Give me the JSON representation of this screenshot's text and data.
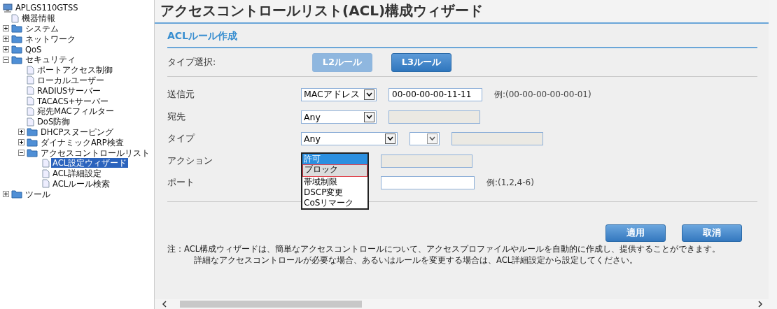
{
  "tree": {
    "root": "APLGS110GTSS",
    "items": [
      {
        "label": "機器情報",
        "kind": "page",
        "selected": false
      },
      {
        "label": "システム",
        "kind": "folder",
        "expanded": false
      },
      {
        "label": "ネットワーク",
        "kind": "folder",
        "expanded": false
      },
      {
        "label": "QoS",
        "kind": "folder",
        "expanded": false
      },
      {
        "label": "セキュリティ",
        "kind": "folder",
        "expanded": true,
        "children": [
          {
            "label": "ポートアクセス制御",
            "kind": "page",
            "selected": false
          },
          {
            "label": "ローカルユーザー",
            "kind": "page",
            "selected": false
          },
          {
            "label": "RADIUSサーバー",
            "kind": "page",
            "selected": false
          },
          {
            "label": "TACACS+サーバー",
            "kind": "page",
            "selected": false
          },
          {
            "label": "宛先MACフィルター",
            "kind": "page",
            "selected": false
          },
          {
            "label": "DoS防御",
            "kind": "page",
            "selected": false
          },
          {
            "label": "DHCPスヌーピング",
            "kind": "folder",
            "expanded": false
          },
          {
            "label": "ダイナミックARP検査",
            "kind": "folder",
            "expanded": false
          },
          {
            "label": "アクセスコントロールリスト",
            "kind": "folder",
            "expanded": true,
            "children": [
              {
                "label": "ACL設定ウィザード",
                "kind": "page",
                "selected": true
              },
              {
                "label": "ACL詳細設定",
                "kind": "page",
                "selected": false
              },
              {
                "label": "ACLルール検索",
                "kind": "page",
                "selected": false
              }
            ]
          }
        ]
      },
      {
        "label": "ツール",
        "kind": "folder",
        "expanded": false
      }
    ]
  },
  "page_title": "アクセスコントロールリスト(ACL)構成ウィザード",
  "section_title": "ACLルール作成",
  "type_select": {
    "label": "タイプ選択:",
    "buttons": [
      {
        "label": "L2ルール",
        "selected": false
      },
      {
        "label": "L3ルール",
        "selected": true
      }
    ]
  },
  "rows": [
    {
      "label": "送信元",
      "select": {
        "value": "MACアドレス"
      },
      "input": {
        "value": "00-00-00-00-11-11",
        "disabled": false
      },
      "hint": "例:(00-00-00-00-00-01)"
    },
    {
      "label": "宛先",
      "select": {
        "value": "Any"
      },
      "input": {
        "disabled": true
      }
    },
    {
      "label": "タイプ",
      "select": {
        "value": "Any"
      },
      "select2": {},
      "input": {
        "disabled": true
      }
    },
    {
      "label": "アクション",
      "input": {
        "disabled": true
      }
    },
    {
      "label": "ポート",
      "input": {
        "disabled": false
      },
      "hint": "例:(1,2,4-6)"
    }
  ],
  "action_list": {
    "options": [
      {
        "label": "許可",
        "selected": true,
        "hovered": false
      },
      {
        "label": "ブロック",
        "selected": false,
        "hovered": true
      },
      {
        "label": "帯域制限",
        "selected": false,
        "hovered": false
      },
      {
        "label": "DSCP変更",
        "selected": false,
        "hovered": false
      },
      {
        "label": "CoSリマーク",
        "selected": false,
        "hovered": false
      }
    ]
  },
  "buttons": [
    {
      "label": "適用"
    },
    {
      "label": "取消"
    }
  ],
  "note": [
    "注：ACL構成ウィザードは、簡単なアクセスコントロールについて、アクセスプロファイルやルールを自動的に作成し、提供することができます。",
    "詳細なアクセスコントロールが必要な場合、あるいはルールを変更する場合は、ACL詳細設定から設定してください。"
  ]
}
